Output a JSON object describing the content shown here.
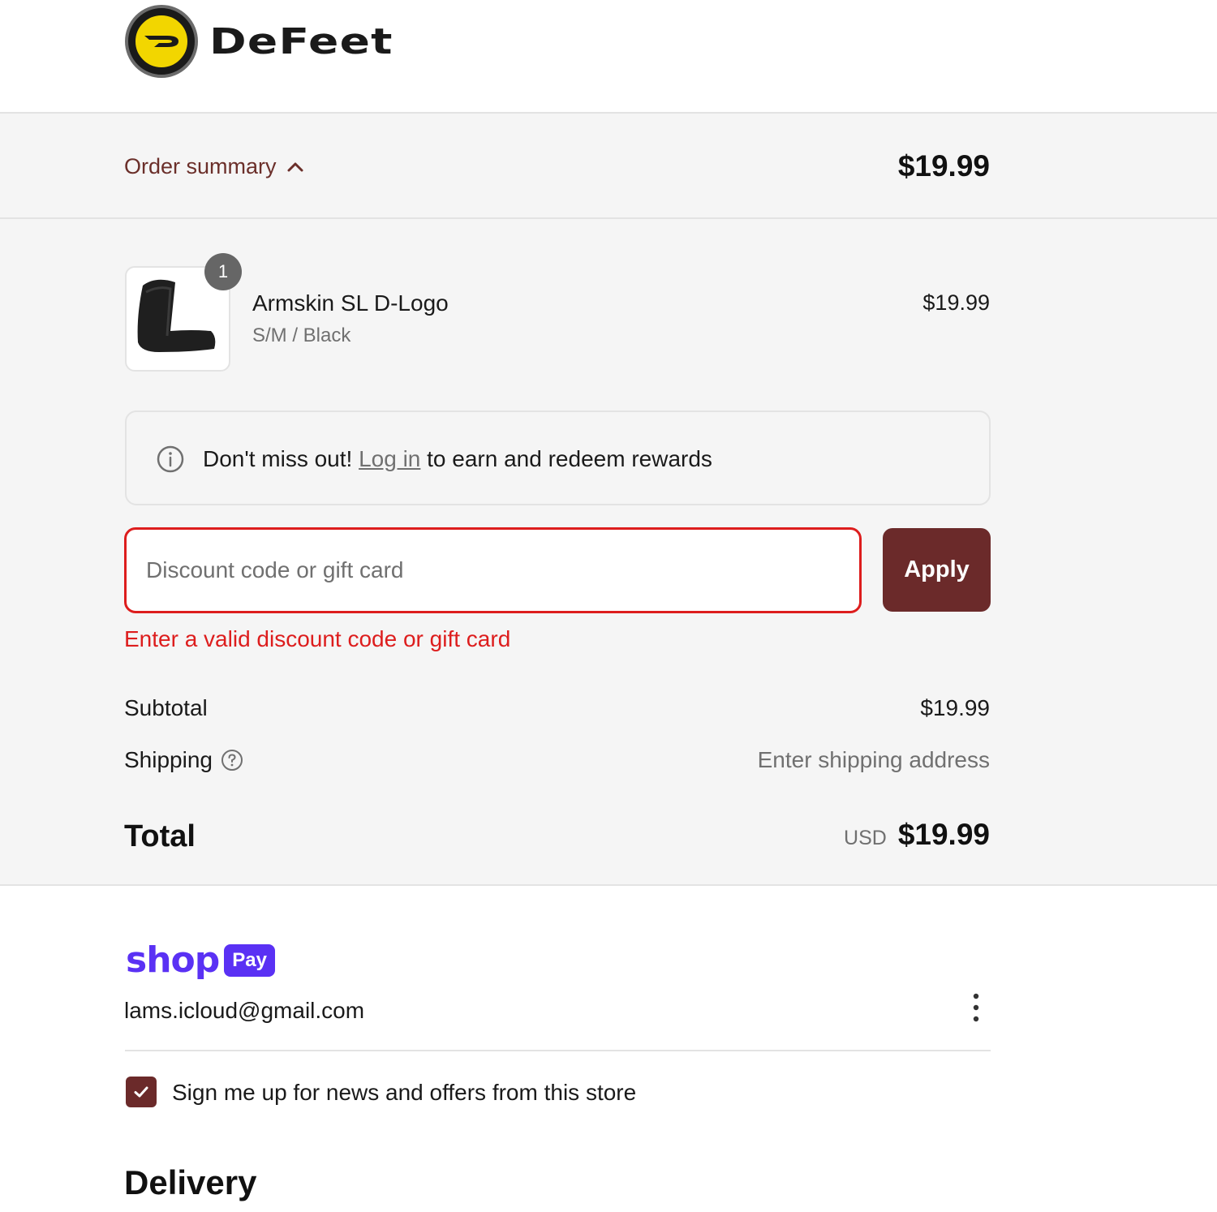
{
  "brand": {
    "name": "DeFeet"
  },
  "summary": {
    "toggle_label": "Order summary",
    "total": "$19.99"
  },
  "cart": {
    "items": [
      {
        "quantity": "1",
        "name": "Armskin SL D-Logo",
        "variant": "S/M / Black",
        "price": "$19.99"
      }
    ]
  },
  "rewards": {
    "prefix": "Don't miss out!",
    "link": "Log in",
    "suffix": "to earn and redeem rewards"
  },
  "discount": {
    "placeholder": "Discount code or gift card",
    "value": "",
    "apply_label": "Apply",
    "error": "Enter a valid discount code or gift card"
  },
  "totals": {
    "subtotal_label": "Subtotal",
    "subtotal_value": "$19.99",
    "shipping_label": "Shipping",
    "shipping_value": "Enter shipping address",
    "total_label": "Total",
    "currency": "USD",
    "total_value": "$19.99"
  },
  "shop_pay": {
    "word": "shop",
    "pill": "Pay",
    "email": "lams.icloud@gmail.com"
  },
  "newsletter": {
    "checked": true,
    "label": "Sign me up for news and offers from this store"
  },
  "delivery": {
    "heading": "Delivery"
  },
  "colors": {
    "accent": "#6b2a2a",
    "error": "#dd1d1d",
    "shop_pay": "#5a31f4",
    "summary_bg": "#f5f5f5"
  },
  "icons": [
    "brand-logo-icon",
    "chevron-up-icon",
    "info-icon",
    "help-circle-icon",
    "more-vertical-icon",
    "checkmark-icon"
  ]
}
